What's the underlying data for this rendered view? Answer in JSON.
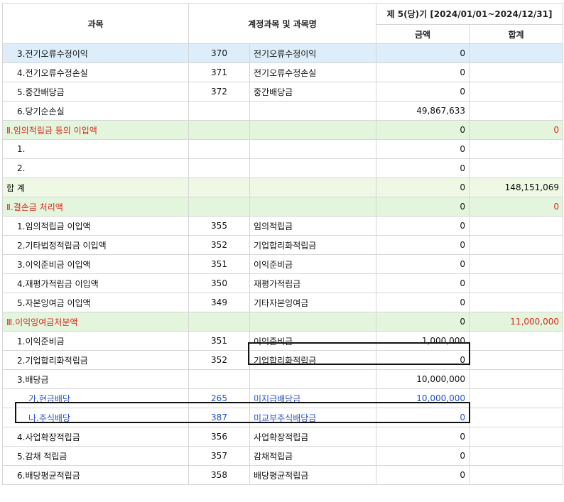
{
  "header": {
    "col_subject": "과목",
    "col_account": "계정과목 및 과목명",
    "col_period": "제 5(당)기 [2024/01/01~2024/12/31]",
    "col_amount": "금액",
    "col_total": "합계"
  },
  "rows": [
    {
      "name": "3.전기오류수정이익",
      "code": "370",
      "account": "전기오류수정이익",
      "amount": "0",
      "total": "",
      "type": "selected",
      "indent": 1
    },
    {
      "name": "4.전기오류수정손실",
      "code": "371",
      "account": "전기오류수정손실",
      "amount": "0",
      "total": "",
      "type": "normal",
      "indent": 1
    },
    {
      "name": "5.중간배당금",
      "code": "372",
      "account": "중간배당금",
      "amount": "0",
      "total": "",
      "type": "normal",
      "indent": 1
    },
    {
      "name": "6.당기순손실",
      "code": "",
      "account": "",
      "amount": "49,867,633",
      "total": "",
      "type": "normal",
      "indent": 1
    },
    {
      "name": "Ⅱ.임의적립금 등의 이입액",
      "code": "",
      "account": "",
      "amount": "0",
      "total": "0",
      "type": "section",
      "indent": 0
    },
    {
      "name": "1.",
      "code": "",
      "account": "",
      "amount": "0",
      "total": "",
      "type": "normal",
      "indent": 1
    },
    {
      "name": "2.",
      "code": "",
      "account": "",
      "amount": "0",
      "total": "",
      "type": "normal",
      "indent": 1
    },
    {
      "name": "합 계",
      "code": "",
      "account": "",
      "amount": "0",
      "total": "148,151,069",
      "type": "sum",
      "indent": 0
    },
    {
      "name": "Ⅱ.결손금 처리액",
      "code": "",
      "account": "",
      "amount": "0",
      "total": "0",
      "type": "section",
      "indent": 0
    },
    {
      "name": "1.임의적립금 이입액",
      "code": "355",
      "account": "임의적립금",
      "amount": "0",
      "total": "",
      "type": "normal",
      "indent": 1
    },
    {
      "name": "2.기타법정적립금 이입액",
      "code": "352",
      "account": "기업합리화적립금",
      "amount": "0",
      "total": "",
      "type": "normal",
      "indent": 1
    },
    {
      "name": "3.이익준비금 이입액",
      "code": "351",
      "account": "이익준비금",
      "amount": "0",
      "total": "",
      "type": "normal",
      "indent": 1
    },
    {
      "name": "4.재평가적립금 이입액",
      "code": "350",
      "account": "재평가적립금",
      "amount": "0",
      "total": "",
      "type": "normal",
      "indent": 1
    },
    {
      "name": "5.자본잉여금 이입액",
      "code": "349",
      "account": "기타자본잉여금",
      "amount": "0",
      "total": "",
      "type": "normal",
      "indent": 1
    },
    {
      "name": "Ⅲ.이익잉여금처분액",
      "code": "",
      "account": "",
      "amount": "0",
      "total": "11,000,000",
      "type": "section",
      "indent": 0
    },
    {
      "name": "1.이익준비금",
      "code": "351",
      "account": "이익준비금",
      "amount": "1,000,000",
      "total": "",
      "type": "normal",
      "indent": 1
    },
    {
      "name": "2.기업합리화적립금",
      "code": "352",
      "account": "기업합리화적립금",
      "amount": "0",
      "total": "",
      "type": "normal",
      "indent": 1
    },
    {
      "name": "3.배당금",
      "code": "",
      "account": "",
      "amount": "10,000,000",
      "total": "",
      "type": "normal",
      "indent": 1
    },
    {
      "name": "가.현금배당",
      "code": "265",
      "account": "미지급배당금",
      "amount": "10,000,000",
      "total": "",
      "type": "blue",
      "indent": 2
    },
    {
      "name": "나.주식배당",
      "code": "387",
      "account": "미교부주식배당금",
      "amount": "0",
      "total": "",
      "type": "blue",
      "indent": 2
    },
    {
      "name": "4.사업확장적립금",
      "code": "356",
      "account": "사업확장적립금",
      "amount": "0",
      "total": "",
      "type": "normal",
      "indent": 1
    },
    {
      "name": "5.감채 적립금",
      "code": "357",
      "account": "감채적립금",
      "amount": "0",
      "total": "",
      "type": "normal",
      "indent": 1
    },
    {
      "name": "6.배당평균적립금",
      "code": "358",
      "account": "배당평균적립금",
      "amount": "0",
      "total": "",
      "type": "normal",
      "indent": 1
    }
  ]
}
